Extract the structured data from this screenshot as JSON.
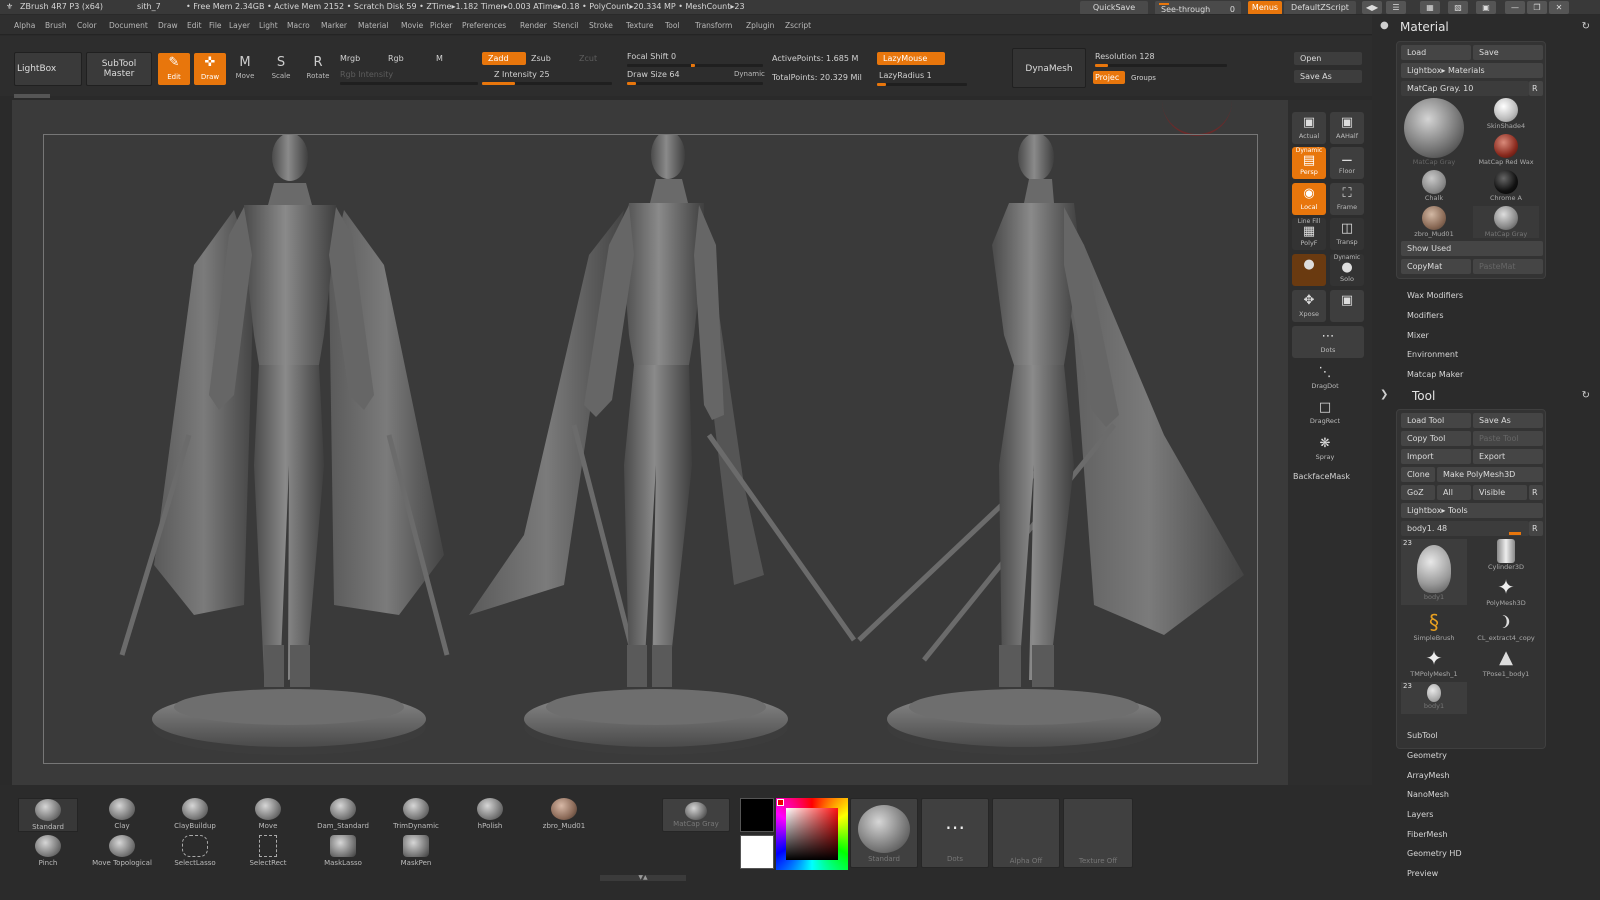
{
  "titlebar": {
    "app": "ZBrush 4R7 P3 (x64)",
    "doc": "sith_7",
    "stats": "• Free Mem 2.34GB • Active Mem 2152 • Scratch Disk 59 • ZTime▸1.182 Timer▸0.003 ATime▸0.18 • PolyCount▸20.334 MP • MeshCount▸23",
    "quicksave": "QuickSave",
    "seethrough": "See-through",
    "seethrough_value": "0",
    "menus": "Menus",
    "script": "DefaultZScript"
  },
  "menu": [
    "Alpha",
    "Brush",
    "Color",
    "Document",
    "Draw",
    "Edit",
    "File",
    "Layer",
    "Light",
    "Macro",
    "Marker",
    "Material",
    "Movie",
    "Picker",
    "Preferences",
    "Render",
    "Stencil",
    "Stroke",
    "Texture",
    "Tool",
    "Transform",
    "Zplugin",
    "Zscript"
  ],
  "toolbar": {
    "lightbox": "LightBox",
    "subtool_master": "SubTool Master",
    "edit": "Edit",
    "draw": "Draw",
    "move": "Move",
    "scale": "Scale",
    "rotate": "Rotate",
    "mrgb": "Mrgb",
    "rgb": "Rgb",
    "m": "M",
    "rgb_intensity": "Rgb Intensity",
    "zadd": "Zadd",
    "zsub": "Zsub",
    "zcut": "Zcut",
    "z_intensity": "Z Intensity 25",
    "z_intensity_value": 25,
    "focal_shift": "Focal Shift 0",
    "draw_size": "Draw Size 64",
    "draw_size_value": 64,
    "dynamic": "Dynamic",
    "active_points": "ActivePoints: 1.685 M",
    "total_points": "TotalPoints: 20.329 Mil",
    "lazymouse": "LazyMouse",
    "lazyradius": "LazyRadius 1",
    "dynamesh": "DynaMesh",
    "resolution": "Resolution 128",
    "project": "Projec",
    "groups": "Groups",
    "open": "Open",
    "save_as": "Save As"
  },
  "shelf": {
    "actual": "Actual",
    "aahalf": "AAHalf",
    "dynamic": "Dynamic",
    "persp": "Persp",
    "floor": "Floor",
    "local": "Local",
    "frame": "Frame",
    "linefill": "Line Fill",
    "polyf": "PolyF",
    "transp": "Transp",
    "solo_dynamic": "Dynamic",
    "solo": "Solo",
    "xpose": "Xpose",
    "dots": "Dots",
    "dragdot": "DragDot",
    "dragrect": "DragRect",
    "spray": "Spray",
    "backfacemask": "BackfaceMask"
  },
  "material_panel": {
    "title": "Material",
    "load": "Load",
    "save": "Save",
    "lightbox_materials": "Lightbox▸ Materials",
    "current": "MatCap Gray. 10",
    "r": "R",
    "items": [
      "MatCap Gray",
      "SkinShade4",
      "MatCap Red Wax",
      "Chalk",
      "Chrome A",
      "zbro_Mud01",
      "MatCap Gray"
    ],
    "show_used": "Show Used",
    "copymat": "CopyMat",
    "pastemat": "PasteMat",
    "subs": [
      "Wax Modifiers",
      "Modifiers",
      "Mixer",
      "Environment",
      "Matcap Maker"
    ]
  },
  "tool_panel": {
    "title": "Tool",
    "load_tool": "Load Tool",
    "save_as": "Save As",
    "copy_tool": "Copy Tool",
    "paste_tool": "Paste Tool",
    "import": "Import",
    "export": "Export",
    "clone": "Clone",
    "make_polymesh": "Make PolyMesh3D",
    "goz": "GoZ",
    "all": "All",
    "visible": "Visible",
    "r": "R",
    "lightbox_tools": "Lightbox▸ Tools",
    "current": "body1. 48",
    "count_a": "23",
    "count_b": "23",
    "items": [
      "body1",
      "Cylinder3D",
      "PolyMesh3D",
      "SimpleBrush",
      "CL_extract4_copy",
      "TMPolyMesh_1",
      "TPose1_body1",
      "body1"
    ],
    "subs": [
      "SubTool",
      "Geometry",
      "ArrayMesh",
      "NanoMesh",
      "Layers",
      "FiberMesh",
      "Geometry HD",
      "Preview"
    ]
  },
  "bottom": {
    "brushes_row1": [
      "Standard",
      "Clay",
      "ClayBuildup",
      "Move",
      "Dam_Standard",
      "TrimDynamic",
      "hPolish",
      "zbro_Mud01"
    ],
    "brushes_row2": [
      "Pinch",
      "Move Topological",
      "SelectLasso",
      "SelectRect",
      "MaskLasso",
      "MaskPen"
    ],
    "material": "MatCap Gray",
    "stroke_brush": "Standard",
    "stroke": "Dots",
    "alpha": "Alpha Off",
    "texture": "Texture Off"
  },
  "colors": {
    "accent": "#e8760c",
    "bg": "#2a2a2a",
    "canvas": "#3a3a3a"
  }
}
